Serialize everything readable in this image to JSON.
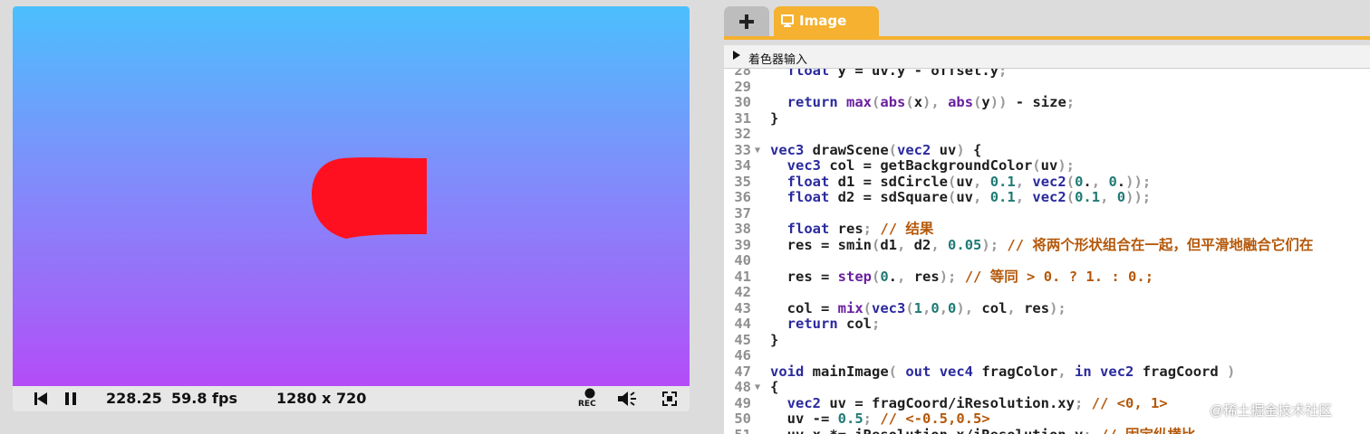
{
  "player": {
    "time": "228.25",
    "fps": "59.8 fps",
    "resolution": "1280 x 720",
    "rec_label": "REC",
    "colors": {
      "gradient_top": "#4cbffd",
      "gradient_bottom": "#b44cf8",
      "shape": "#ff1020"
    }
  },
  "editor": {
    "tab_add_label": "+",
    "tab_image_label": "Image",
    "input_bar_label": "着色器输入",
    "colors": {
      "accent": "#f5b12f"
    }
  },
  "code": {
    "lines": [
      {
        "n": "28",
        "fold": "",
        "text": "  float y = uv.y - offset.y;"
      },
      {
        "n": "29",
        "fold": "",
        "text": ""
      },
      {
        "n": "30",
        "fold": "",
        "text": "  return max(abs(x), abs(y)) - size;"
      },
      {
        "n": "31",
        "fold": "",
        "text": "}"
      },
      {
        "n": "32",
        "fold": "",
        "text": ""
      },
      {
        "n": "33",
        "fold": "▼",
        "text": "vec3 drawScene(vec2 uv) {"
      },
      {
        "n": "34",
        "fold": "",
        "text": "  vec3 col = getBackgroundColor(uv);"
      },
      {
        "n": "35",
        "fold": "",
        "text": "  float d1 = sdCircle(uv, 0.1, vec2(0., 0.));"
      },
      {
        "n": "36",
        "fold": "",
        "text": "  float d2 = sdSquare(uv, 0.1, vec2(0.1, 0));"
      },
      {
        "n": "37",
        "fold": "",
        "text": ""
      },
      {
        "n": "38",
        "fold": "",
        "text": "  float res; // 结果"
      },
      {
        "n": "39",
        "fold": "",
        "text": "  res = smin(d1, d2, 0.05); // 将两个形状组合在一起，但平滑地融合它们在"
      },
      {
        "n": "40",
        "fold": "",
        "text": ""
      },
      {
        "n": "41",
        "fold": "",
        "text": "  res = step(0., res); // 等同 > 0. ? 1. : 0.;"
      },
      {
        "n": "42",
        "fold": "",
        "text": ""
      },
      {
        "n": "43",
        "fold": "",
        "text": "  col = mix(vec3(1,0,0), col, res);"
      },
      {
        "n": "44",
        "fold": "",
        "text": "  return col;"
      },
      {
        "n": "45",
        "fold": "",
        "text": "}"
      },
      {
        "n": "46",
        "fold": "",
        "text": ""
      },
      {
        "n": "47",
        "fold": "",
        "text": "void mainImage( out vec4 fragColor, in vec2 fragCoord )"
      },
      {
        "n": "48",
        "fold": "▼",
        "text": "{"
      },
      {
        "n": "49",
        "fold": "",
        "text": "  vec2 uv = fragCoord/iResolution.xy; // <0, 1>"
      },
      {
        "n": "50",
        "fold": "",
        "text": "  uv -= 0.5; // <-0.5,0.5>"
      },
      {
        "n": "51",
        "fold": "",
        "text": "  uv.x *= iResolution.x/iResolution.y; // 固定纵横比"
      }
    ]
  },
  "watermark": "@稀土掘金技术社区"
}
